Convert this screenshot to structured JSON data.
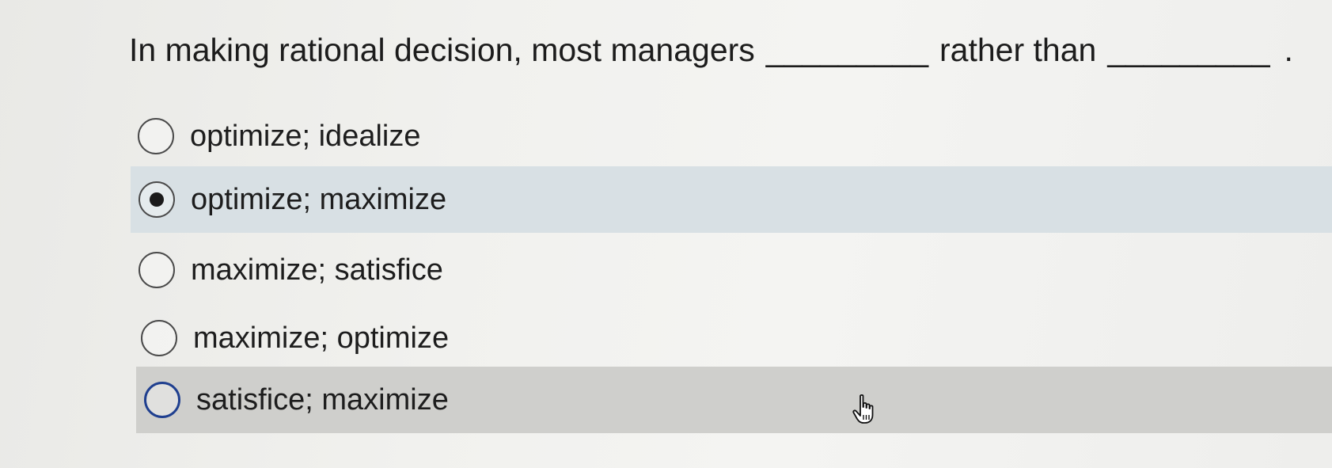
{
  "question": {
    "part1": "In making rational decision, most managers",
    "blank1": "_________",
    "part2": "rather than",
    "blank2": "_________",
    "end": "."
  },
  "options": [
    {
      "label": "optimize; idealize",
      "selected": false
    },
    {
      "label": "optimize; maximize",
      "selected": true
    },
    {
      "label": "maximize; satisfice",
      "selected": false
    },
    {
      "label": "maximize; optimize",
      "selected": false
    },
    {
      "label": "satisfice; maximize",
      "selected": false,
      "hovered": true
    }
  ],
  "colors": {
    "selected_row": "#d8e0e4",
    "hover_row": "#cfcfcc",
    "focus_ring": "#1f3f8f"
  },
  "icons": {
    "cursor": "hand-pointer-icon"
  }
}
